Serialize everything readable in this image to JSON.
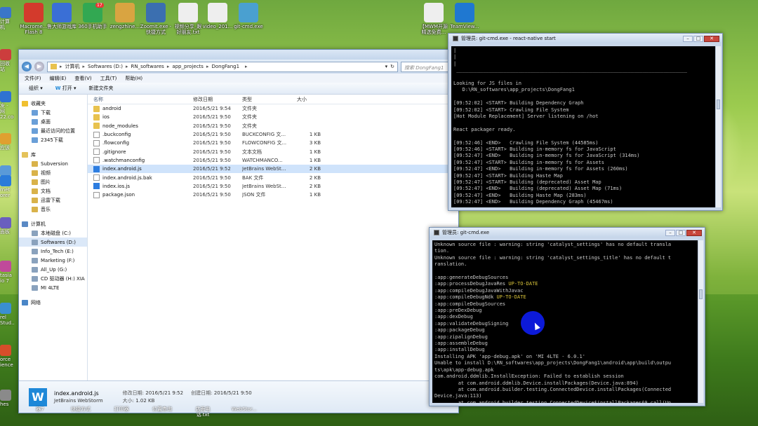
{
  "desktop": {
    "top_icons": [
      {
        "label": "Macrome...\nFlash 8",
        "color": "#d33a2c"
      },
      {
        "label": "鲁大师游戏库",
        "color": "#3a6fd6"
      },
      {
        "label": "360手机助手",
        "color": "#32a852"
      },
      {
        "label": "zengzhine...",
        "color": "#d9a441"
      },
      {
        "label": "ZoomIt.exe -\n快捷方式",
        "color": "#3b6fb0"
      },
      {
        "label": "视频分享_跟\n好朋友.txt",
        "color": "#eeeeee"
      },
      {
        "label": "video_201...",
        "color": "#eeeeee"
      },
      {
        "label": "git-cmd.exe",
        "color": "#4aa0d0"
      },
      {
        "label": "【MWM开源\n精选免费...",
        "color": "#eeeeee"
      },
      {
        "label": "TeamView...",
        "color": "#1f78d1"
      }
    ],
    "top_icon_badge": "17",
    "left_icons": [
      "计算机",
      "回收站",
      "发 - 网\n22.com",
      "应该",
      "2",
      "rnet\norer",
      "面板",
      "tasia\nio 7",
      "rel\nStud...",
      "orce\nience",
      "hes\n"
    ],
    "bottom_icons": [
      "器7",
      "快捷方式",
      "打印器",
      "位置查询",
      "店面电话.txt",
      "WebStor..."
    ]
  },
  "explorer": {
    "breadcrumb": [
      "计算机",
      "Softwares (D:)",
      "RN_softwares",
      "app_projects",
      "DongFang1"
    ],
    "search_placeholder": "搜索 DongFang1",
    "menu": [
      "文件(F)",
      "编辑(E)",
      "查看(V)",
      "工具(T)",
      "帮助(H)"
    ],
    "toolbar": {
      "organize": "组织 ▾",
      "open": "打开 ▾",
      "new_folder": "新建文件夹"
    },
    "nav": {
      "favorites": "收藏夹",
      "favorites_items": [
        "下载",
        "桌面",
        "最近访问的位置",
        "2345下载"
      ],
      "library": "库",
      "library_items": [
        "Subversion",
        "视频",
        "图片",
        "文档",
        "迅雷下载",
        "音乐"
      ],
      "computer": "计算机",
      "computer_items": [
        "本地磁盘 (C:)",
        "Softwares (D:)",
        "Info_Tech (E:)",
        "Marketing (F:)",
        "All_Up (G:)",
        "CD 驱动器 (H:) XIA",
        "MI 4LTE"
      ],
      "network": "网络"
    },
    "columns": {
      "name": "名称",
      "date": "修改日期",
      "type": "类型",
      "size": "大小"
    },
    "files": [
      {
        "name": "android",
        "date": "2016/5/21 9:54",
        "type": "文件夹",
        "size": "",
        "kind": "folder"
      },
      {
        "name": "ios",
        "date": "2016/5/21 9:50",
        "type": "文件夹",
        "size": "",
        "kind": "folder"
      },
      {
        "name": "node_modules",
        "date": "2016/5/21 9:50",
        "type": "文件夹",
        "size": "",
        "kind": "folder"
      },
      {
        "name": ".buckconfig",
        "date": "2016/5/21 9:50",
        "type": "BUCKCONFIG 文...",
        "size": "1 KB",
        "kind": "file"
      },
      {
        "name": ".flowconfig",
        "date": "2016/5/21 9:50",
        "type": "FLOWCONFIG 文...",
        "size": "3 KB",
        "kind": "file"
      },
      {
        "name": ".gitignore",
        "date": "2016/5/21 9:50",
        "type": "文本文档",
        "size": "1 KB",
        "kind": "file"
      },
      {
        "name": ".watchmanconfig",
        "date": "2016/5/21 9:50",
        "type": "WATCHMANCO...",
        "size": "1 KB",
        "kind": "file"
      },
      {
        "name": "index.android.js",
        "date": "2016/5/21 9:52",
        "type": "JetBrains WebSt...",
        "size": "2 KB",
        "kind": "ws"
      },
      {
        "name": "index.android.js.bak",
        "date": "2016/5/21 9:50",
        "type": "BAK 文件",
        "size": "2 KB",
        "kind": "file"
      },
      {
        "name": "index.ios.js",
        "date": "2016/5/21 9:50",
        "type": "JetBrains WebSt...",
        "size": "2 KB",
        "kind": "ws"
      },
      {
        "name": "package.json",
        "date": "2016/5/21 9:50",
        "type": "JSON 文件",
        "size": "1 KB",
        "kind": "file"
      }
    ],
    "selected_index": 7,
    "details": {
      "filename": "index.android.js",
      "app": "JetBrains WebStorm",
      "modified_label": "修改日期:",
      "modified": "2016/5/21 9:52",
      "created_label": "创建日期:",
      "created": "2016/5/21 9:50",
      "size_label": "大小:",
      "size": "1.02 KB"
    }
  },
  "console1": {
    "title": "管理员: git-cmd.exe - react-native  start",
    "lines": [
      "|",
      "|",
      "|",
      " ______________________________________________________________________________",
      "",
      "Looking for JS files in",
      "   D:\\RN_softwares\\app_projects\\DongFang1",
      "",
      "[09:52:02] <START> Building Dependency Graph",
      "[09:52:02] <START> Crawling File System",
      "[Hot Module Replacement] Server listening on /hot",
      "",
      "React packager ready.",
      "",
      "[09:52:46] <END>   Crawling File System (44585ms)",
      "[09:52:46] <START> Building in-memory fs for JavaScript",
      "[09:52:47] <END>   Building in-memory fs for JavaScript (314ms)",
      "[09:52:47] <START> Building in-memory fs for Assets",
      "[09:52:47] <END>   Building in-memory fs for Assets (260ms)",
      "[09:52:47] <START> Building Haste Map",
      "[09:52:47] <START> Building (deprecated) Asset Map",
      "[09:52:47] <END>   Building (deprecated) Asset Map (71ms)",
      "[09:52:47] <END>   Building Haste Map (283ms)",
      "[09:52:47] <END>   Building Dependency Graph (45467ms)"
    ]
  },
  "console2": {
    "title": "管理员: git-cmd.exe",
    "lines": [
      "Unknown source file : warning: string 'catalyst_settings' has no default transla",
      "tion.",
      "Unknown source file : warning: string 'catalyst_settings_title' has no default t",
      "ranslation.",
      "",
      ":app:generateDebugSources",
      ":app:processDebugJavaRes UP-TO-DATE",
      ":app:compileDebugJavaWithJavac",
      ":app:compileDebugNdk UP-TO-DATE",
      ":app:compileDebugSources",
      ":app:preDexDebug",
      ":app:dexDebug",
      ":app:validateDebugSigning",
      ":app:packageDebug",
      ":app:zipalignDebug",
      ":app:assembleDebug",
      ":app:installDebug",
      "Installing APK 'app-debug.apk' on 'MI 4LTE - 6.0.1'",
      "Unable to install D:\\RN_softwares\\app_projects\\DongFang1\\android\\app\\build\\outpu",
      "ts\\apk\\app-debug.apk",
      "com.android.ddmlib.InstallException: Failed to establish session",
      "        at com.android.ddmlib.Device.installPackages(Device.java:894)",
      "        at com.android.builder.testing.ConnectedDevice.installPackages(Connected",
      "Device.java:113)",
      "        at com.android.builder.testing.ConnectedDevice$installPackages$0.call(Un"
    ]
  },
  "colors": {
    "console_bg": "#000000",
    "console_text": "#c9c9c9",
    "up_to_date": "#d8c33a",
    "cursor_dot": "#0c1ad8"
  }
}
